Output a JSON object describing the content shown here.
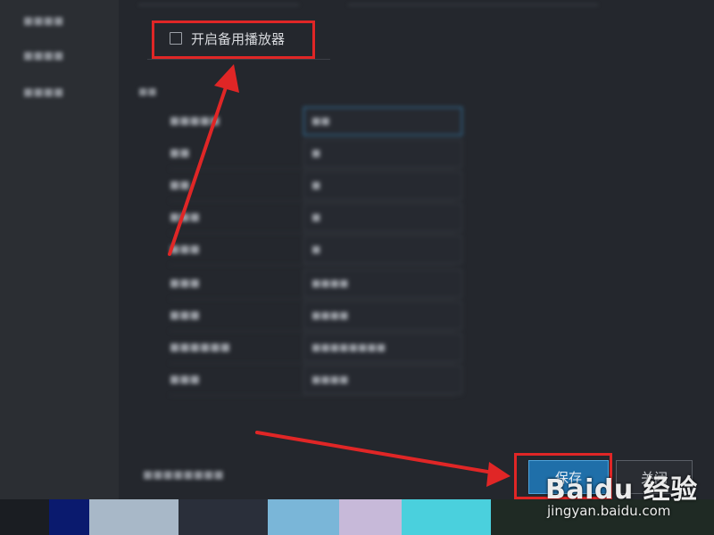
{
  "backup_player": {
    "checked": false,
    "label": "开启备用播放器"
  },
  "footer": {
    "save_label": "保存",
    "close_label": "关闭"
  },
  "watermark": {
    "logo": "Baidu 经验",
    "url": "jingyan.baidu.com"
  },
  "colors": {
    "annotation_red": "#e02626",
    "primary_button": "#1f6fa9",
    "background": "#22252b"
  },
  "icons": [
    "checkbox-icon",
    "annotation-arrow-icon"
  ]
}
